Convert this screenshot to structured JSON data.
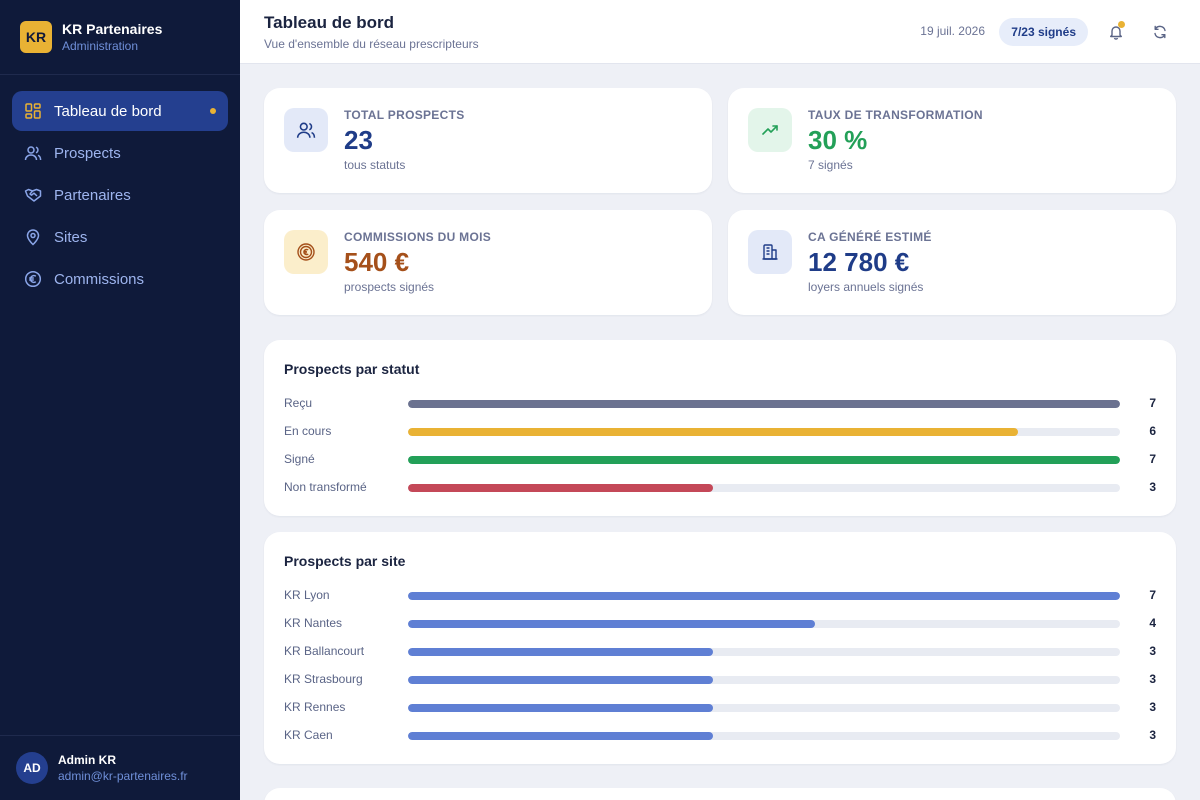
{
  "brand": {
    "logo": "KR",
    "name": "KR Partenaires",
    "subtitle": "Administration"
  },
  "nav": [
    {
      "label": "Tableau de bord",
      "icon": "dashboard-icon",
      "active": true
    },
    {
      "label": "Prospects",
      "icon": "users-icon"
    },
    {
      "label": "Partenaires",
      "icon": "handshake-icon"
    },
    {
      "label": "Sites",
      "icon": "map-pin-icon"
    },
    {
      "label": "Commissions",
      "icon": "euro-icon"
    }
  ],
  "user": {
    "initials": "AD",
    "name": "Admin KR",
    "email": "admin@kr-partenaires.fr"
  },
  "header": {
    "title": "Tableau de bord",
    "subtitle": "Vue d'ensemble du réseau prescripteurs",
    "date": "19 juil. 2026",
    "badge": "7/23 signés"
  },
  "stats": [
    {
      "label": "TOTAL PROSPECTS",
      "value": "23",
      "note": "tous statuts",
      "icon": "users-icon",
      "color": "#1f3c88",
      "icon_bg": "#e3e9f8"
    },
    {
      "label": "TAUX DE TRANSFORMATION",
      "value": "30 %",
      "note": "7 signés",
      "icon": "trending-up-icon",
      "color": "#23a058",
      "icon_bg": "#e3f5ea"
    },
    {
      "label": "COMMISSIONS DU MOIS",
      "value": "540 €",
      "note": "prospects signés",
      "icon": "euro-coin-icon",
      "color": "#a5501a",
      "icon_bg": "#fbeecb"
    },
    {
      "label": "CA GÉNÉRÉ ESTIMÉ",
      "value": "12 780 €",
      "note": "loyers annuels signés",
      "icon": "building-icon",
      "color": "#1f3c88",
      "icon_bg": "#e3e9f8"
    }
  ],
  "status_panel": {
    "title": "Prospects par statut",
    "rows": [
      {
        "label": "Reçu",
        "value": 7,
        "count": "7",
        "color": "#6b7290"
      },
      {
        "label": "En cours",
        "value": 6,
        "count": "6",
        "color": "#e9b234"
      },
      {
        "label": "Signé",
        "value": 7,
        "count": "7",
        "color": "#23a058"
      },
      {
        "label": "Non transformé",
        "value": 3,
        "count": "3",
        "color": "#c44858"
      }
    ],
    "max": 7
  },
  "site_panel": {
    "title": "Prospects par site",
    "rows": [
      {
        "label": "KR Lyon",
        "value": 7,
        "count": "7",
        "color": "#5f7fd4"
      },
      {
        "label": "KR Nantes",
        "value": 4,
        "count": "4",
        "color": "#5f7fd4"
      },
      {
        "label": "KR Ballancourt",
        "value": 3,
        "count": "3",
        "color": "#5f7fd4"
      },
      {
        "label": "KR Strasbourg",
        "value": 3,
        "count": "3",
        "color": "#5f7fd4"
      },
      {
        "label": "KR Rennes",
        "value": 3,
        "count": "3",
        "color": "#5f7fd4"
      },
      {
        "label": "KR Caen",
        "value": 3,
        "count": "3",
        "color": "#5f7fd4"
      }
    ],
    "max": 7
  }
}
